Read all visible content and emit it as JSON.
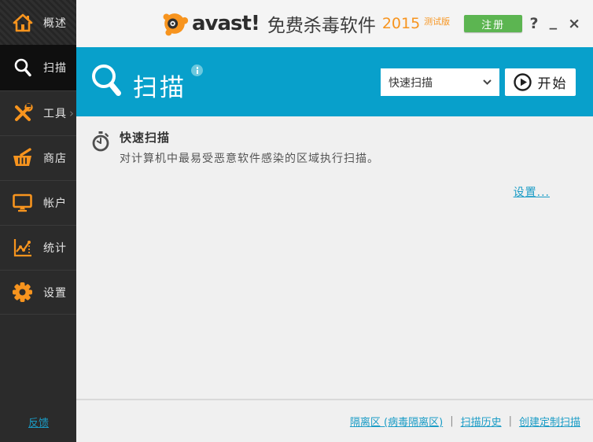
{
  "window_controls": {
    "help": "?",
    "minimize": "_",
    "close": "×"
  },
  "header": {
    "brand": {
      "wordmark": "avast!",
      "product": "免费杀毒软件",
      "year": "2015",
      "edition": "测试版"
    },
    "register_label": "注册"
  },
  "sidebar": {
    "items": [
      {
        "label": "概述",
        "icon": "home-icon",
        "selected": false
      },
      {
        "label": "扫描",
        "icon": "magnifier-icon",
        "selected": true
      },
      {
        "label": "工具",
        "icon": "tools-icon",
        "selected": false,
        "has_submenu": true
      },
      {
        "label": "商店",
        "icon": "basket-icon",
        "selected": false
      },
      {
        "label": "帐户",
        "icon": "monitor-icon",
        "selected": false
      },
      {
        "label": "统计",
        "icon": "chart-icon",
        "selected": false
      },
      {
        "label": "设置",
        "icon": "gear-icon",
        "selected": false
      }
    ],
    "submenu_chevron": "›",
    "feedback_label": "反馈"
  },
  "banner": {
    "title": "扫描",
    "scan_selector": {
      "value": "快速扫描"
    },
    "start_label": "开始"
  },
  "content": {
    "quick_scan": {
      "title": "快速扫描",
      "description": "对计算机中最易受恶意软件感染的区域执行扫描。"
    },
    "settings_link": "设置..."
  },
  "footer": {
    "links": [
      "隔离区 (病毒隔离区)",
      "扫描历史",
      "创建定制扫描"
    ],
    "separator": "|"
  },
  "colors": {
    "banner_cyan": "#08a0cb",
    "link_cyan": "#1a9cc6",
    "accent_orange": "#f7941e",
    "register_green": "#5cb551",
    "sidebar_dark": "#2b2b2b",
    "sidebar_selected": "#0f0f0f",
    "content_bg": "#f0f0f0"
  }
}
